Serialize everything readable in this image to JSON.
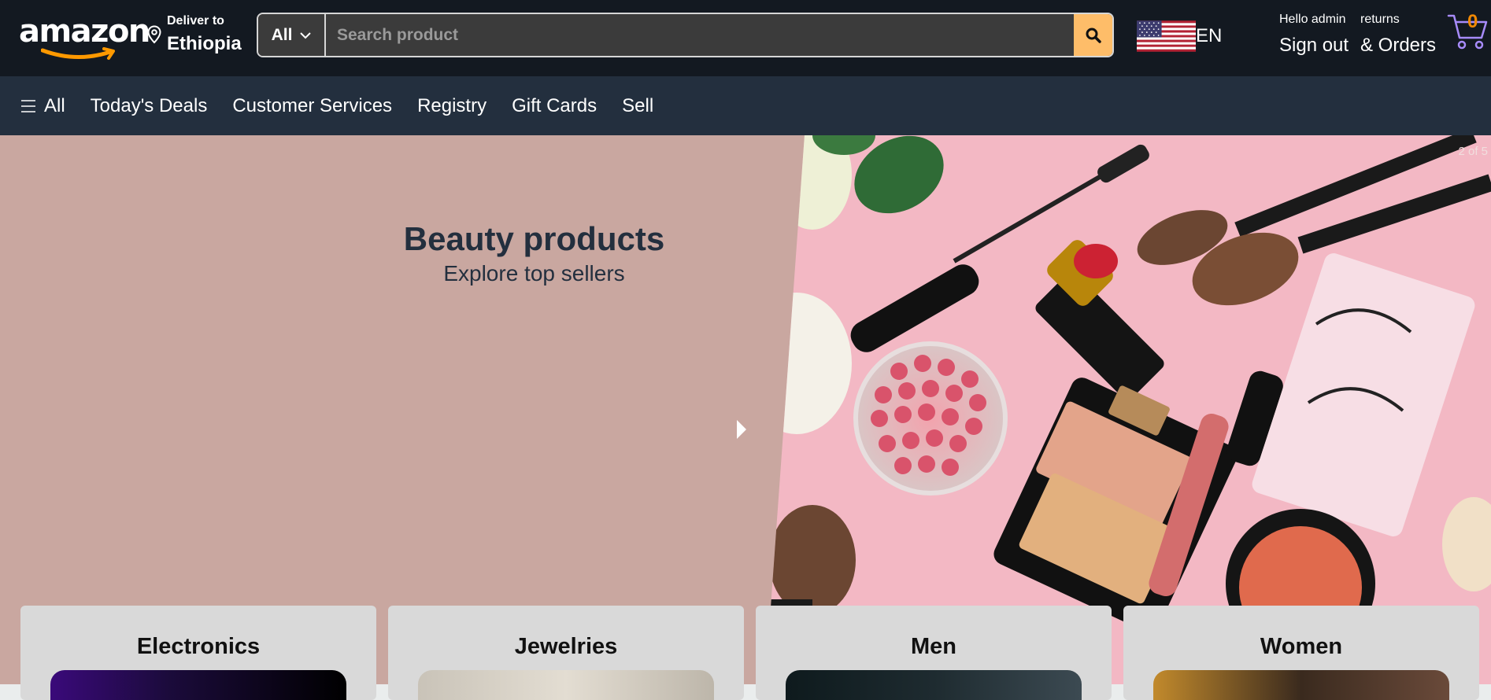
{
  "header": {
    "logo": "amazon",
    "deliver_label": "Deliver to",
    "deliver_location": "Ethiopia",
    "search_category": "All",
    "search_placeholder": "Search product",
    "language": "EN",
    "greeting": "Hello admin",
    "sign_out": "Sign out",
    "returns_label": "returns",
    "orders_label": "& Orders",
    "cart_count": "0"
  },
  "subnav": {
    "items": [
      "All",
      "Today's Deals",
      "Customer Services",
      "Registry",
      "Gift Cards",
      "Sell"
    ]
  },
  "hero": {
    "title": "Beauty products",
    "subtitle": "Explore top sellers",
    "counter": "2 of 5"
  },
  "categories": [
    {
      "title": "Electronics"
    },
    {
      "title": "Jewelries"
    },
    {
      "title": "Men"
    },
    {
      "title": "Women"
    }
  ],
  "colors": {
    "topnav_bg": "#131921",
    "subnav_bg": "#232f3e",
    "search_btn": "#febd69",
    "cart_accent": "#f08804",
    "hero_bg": "#c9a7a0"
  }
}
